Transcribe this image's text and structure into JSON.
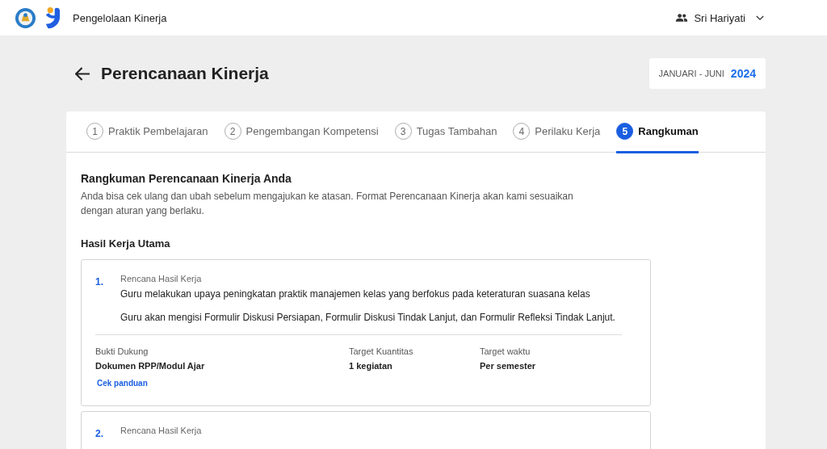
{
  "header": {
    "app_title": "Pengelolaan Kinerja",
    "user": "Sri Hariyati"
  },
  "page": {
    "title": "Perencanaan Kinerja",
    "period": "JANUARI - JUNI",
    "year": "2024"
  },
  "steps": [
    {
      "number": "1",
      "label": "Praktik Pembelajaran",
      "selected": false
    },
    {
      "number": "2",
      "label": "Pengembangan Kompetensi",
      "selected": false
    },
    {
      "number": "3",
      "label": "Tugas Tambahan",
      "selected": false
    },
    {
      "number": "4",
      "label": "Perilaku Kerja",
      "selected": false
    },
    {
      "number": "5",
      "label": "Rangkuman",
      "selected": true
    }
  ],
  "summary": {
    "title": "Rangkuman Perencanaan Kinerja Anda",
    "description": "Anda bisa cek ulang dan ubah sebelum mengajukan ke atasan. Format Perencanaan Kinerja akan kami sesuaikan dengan aturan yang berlaku.",
    "section": "Hasil Kerja Utama"
  },
  "items": [
    {
      "number": "1.",
      "label": "Rencana Hasil Kerja",
      "text": "Guru melakukan upaya peningkatan praktik manajemen kelas yang berfokus pada keteraturan suasana kelas",
      "detail": "Guru akan mengisi Formulir Diskusi Persiapan, Formulir Diskusi Tindak Lanjut, dan Formulir Refleksi Tindak Lanjut.",
      "fields": [
        {
          "label": "Bukti Dukung",
          "value": "Dokumen RPP/Modul Ajar"
        },
        {
          "label": "Target Kuantitas",
          "value": "1 kegiatan"
        },
        {
          "label": "Target waktu",
          "value": "Per semester"
        }
      ],
      "link": "Cek panduan"
    },
    {
      "number": "2.",
      "label": "Rencana Hasil Kerja"
    }
  ]
}
